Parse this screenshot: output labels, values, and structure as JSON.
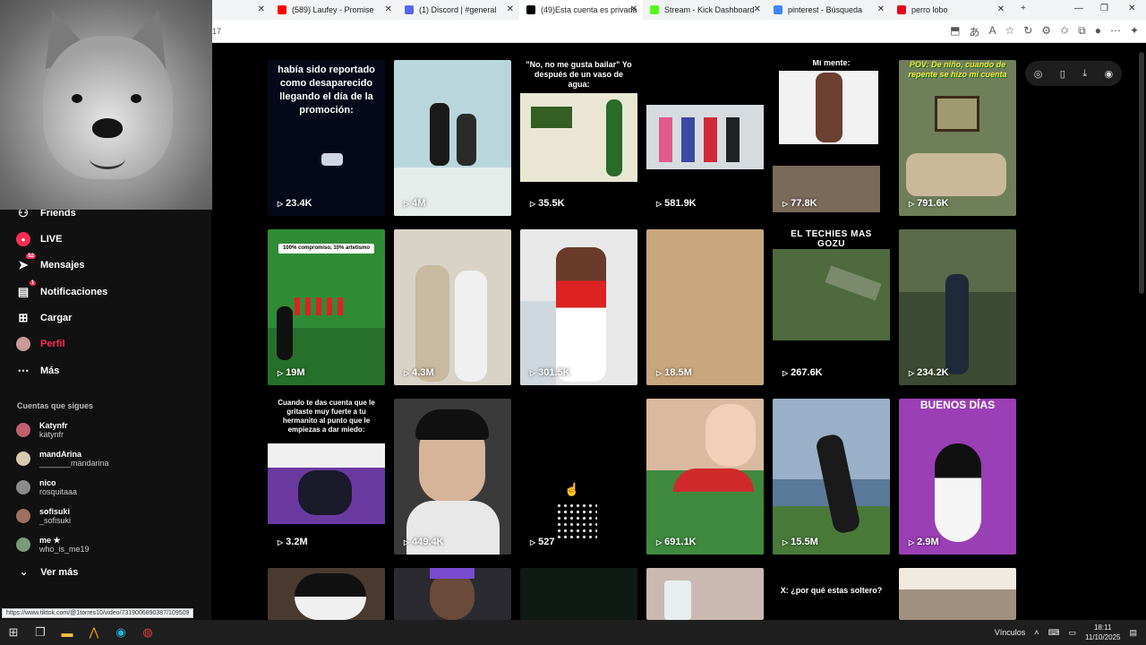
{
  "browser": {
    "tabs": [
      {
        "title": "",
        "favicon_color": "#9e9e9e",
        "active": false
      },
      {
        "title": "(589) Laufey - Promise",
        "favicon_color": "#ff0000",
        "active": false
      },
      {
        "title": "(1) Discord | #general",
        "favicon_color": "#5865f2",
        "active": false
      },
      {
        "title": "(49)Esta cuenta es privada",
        "favicon_color": "#000000",
        "active": true
      },
      {
        "title": "Stream - Kick Dashboard",
        "favicon_color": "#53fc18",
        "active": false
      },
      {
        "title": "pinterest - Búsqueda",
        "favicon_color": "#4285f4",
        "active": false
      },
      {
        "title": "perro lobo",
        "favicon_color": "#e60023",
        "active": false
      }
    ],
    "url_fragment": "17",
    "status_url": "https://www.tiktok.com/@1torres10/video/7319006890387/109509"
  },
  "sidebar": {
    "items": [
      {
        "label": "Friends",
        "icon": "friends-icon",
        "badge": ""
      },
      {
        "label": "LIVE",
        "icon": "live-icon",
        "badge": ""
      },
      {
        "label": "Mensajes",
        "icon": "messages-icon",
        "badge": "52"
      },
      {
        "label": "Notificaciones",
        "icon": "notifications-icon",
        "badge": "1"
      },
      {
        "label": "Cargar",
        "icon": "upload-icon",
        "badge": ""
      },
      {
        "label": "Perfil",
        "icon": "profile-icon",
        "badge": ""
      },
      {
        "label": "Más",
        "icon": "more-icon",
        "badge": ""
      }
    ],
    "following_title": "Cuentas que sigues",
    "following": [
      {
        "name": "Katynfr",
        "handle": "katynfr",
        "avatar_color": "#c06070"
      },
      {
        "name": "mandArina",
        "handle": "_______mandarina",
        "avatar_color": "#d8c8b0"
      },
      {
        "name": "nico",
        "handle": "rosquitaaa",
        "avatar_color": "#8a8a8a"
      },
      {
        "name": "sofisuki",
        "handle": "_sofisuki",
        "avatar_color": "#a07060"
      },
      {
        "name": "me ★",
        "handle": "who_is_me19",
        "avatar_color": "#7a9a7a"
      }
    ],
    "see_more": "Ver más"
  },
  "videos": [
    {
      "views": "23.4K",
      "caption": "había sido reportado como desaparecido llegando el día de la promoción:",
      "bg": "#050818"
    },
    {
      "views": "4M",
      "caption": "",
      "bg": "#b9d6dd"
    },
    {
      "views": "35.5K",
      "caption": "\"No, no me gusta bailar\" Yo después de un vaso de agua:",
      "bg": "#000000"
    },
    {
      "views": "581.9K",
      "caption": "",
      "bg": "#000000"
    },
    {
      "views": "77.8K",
      "caption": "Mi mente:",
      "bg": "#000000"
    },
    {
      "views": "791.6K",
      "caption": "POV: De niño, cuando de repente se hizo mi cuenta",
      "bg": "#6f7f5a"
    },
    {
      "views": "19M",
      "caption": "100% compromiso, 10% artetismo",
      "bg": "#2f8c35"
    },
    {
      "views": "4.3M",
      "caption": "",
      "bg": "#d9d3c7"
    },
    {
      "views": "301.5K",
      "caption": "",
      "bg": "#e8e8e8"
    },
    {
      "views": "18.5M",
      "caption": "",
      "bg": "#c9a77c"
    },
    {
      "views": "267.6K",
      "caption": "EL TECHIES MÁS GOZU",
      "bg": "#000000"
    },
    {
      "views": "234.2K",
      "caption": "",
      "bg": "#3d4a33"
    },
    {
      "views": "3.2M",
      "caption": "Cuando te das cuenta que le gritaste muy fuerte a tu hermanito al punto que le empiezas a dar miedo:",
      "bg": "#000000"
    },
    {
      "views": "449.4K",
      "caption": "",
      "bg": "#3a3a3a"
    },
    {
      "views": "527",
      "caption": "",
      "bg": "#000000"
    },
    {
      "views": "691.1K",
      "caption": "",
      "bg": "#b08070"
    },
    {
      "views": "15.5M",
      "caption": "",
      "bg": "#5a7a9a"
    },
    {
      "views": "2.9M",
      "caption": "BUENOS DÍAS",
      "bg": "#9a3fb5"
    },
    {
      "views": "",
      "caption": "",
      "bg": "#4a3a30"
    },
    {
      "views": "",
      "caption": "",
      "bg": "#2a2a30"
    },
    {
      "views": "",
      "caption": "",
      "bg": "#101a14"
    },
    {
      "views": "",
      "caption": "",
      "bg": "#c9b9b0"
    },
    {
      "views": "",
      "caption": "X: ¿por qué estas soltero?",
      "bg": "#000000"
    },
    {
      "views": "",
      "caption": "",
      "bg": "#a09080"
    }
  ],
  "taskbar": {
    "links_label": "Vínculos",
    "time": "18:11",
    "date": "11/10/2025"
  }
}
